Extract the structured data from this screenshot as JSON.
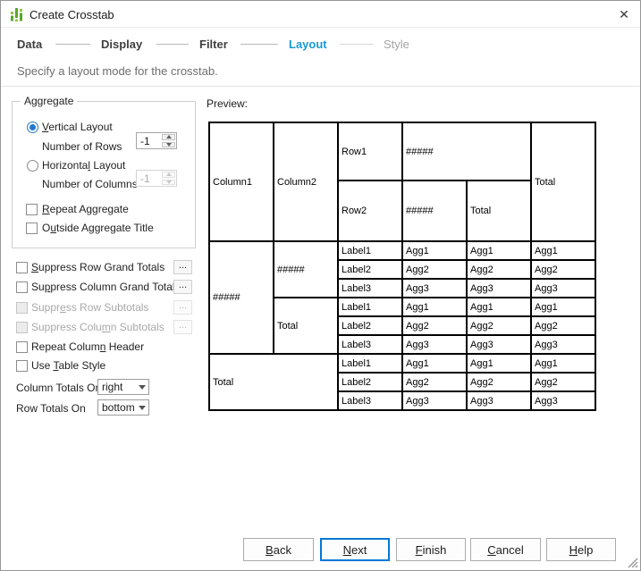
{
  "window": {
    "title": "Create Crosstab",
    "close_glyph": "✕"
  },
  "colors": {
    "active_step": "#1899d6",
    "default_button_border": "#0078d7",
    "app_icon_green": "#5ba829"
  },
  "steps": [
    {
      "label": "Data",
      "state": "done"
    },
    {
      "label": "Display",
      "state": "done"
    },
    {
      "label": "Filter",
      "state": "done"
    },
    {
      "label": "Layout",
      "state": "active"
    },
    {
      "label": "Style",
      "state": "upcoming"
    }
  ],
  "subtitle": "Specify a layout mode for the crosstab.",
  "aggregate": {
    "legend": "Aggregate",
    "vertical_layout": {
      "pre": "",
      "key": "V",
      "post": "ertical Layout",
      "selected": true
    },
    "number_of_rows": {
      "label": "Number of Rows",
      "value": "-1"
    },
    "horizontal_layout": {
      "pre": "Horizonta",
      "key": "l",
      "post": " Layout",
      "selected": false
    },
    "number_of_columns": {
      "label": "Number of Columns",
      "value": "-1",
      "disabled": true
    },
    "repeat_aggregate": {
      "pre": "",
      "key": "R",
      "post": "epeat Aggregate",
      "checked": false
    },
    "outside_aggregate_title": {
      "pre": "O",
      "key": "u",
      "post": "tside Aggregate Title",
      "checked": false
    }
  },
  "options": [
    {
      "pre": "",
      "key": "S",
      "post": "uppress Row Grand Totals",
      "checked": false,
      "disabled": false,
      "more": "..."
    },
    {
      "pre": "Su",
      "key": "p",
      "post": "press Column Grand Totals",
      "checked": false,
      "disabled": false,
      "more": "..."
    },
    {
      "pre": "Suppr",
      "key": "e",
      "post": "ss Row Subtotals",
      "checked": false,
      "disabled": true,
      "more": "..."
    },
    {
      "pre": "Suppress Colu",
      "key": "m",
      "post": "n Subtotals",
      "checked": false,
      "disabled": true,
      "more": "..."
    },
    {
      "pre": "Repeat Colum",
      "key": "n",
      "post": " Header",
      "checked": false,
      "disabled": false
    },
    {
      "pre": "Use ",
      "key": "T",
      "post": "able Style",
      "checked": false,
      "disabled": false
    }
  ],
  "totals": {
    "column": {
      "label": "Column Totals On",
      "value": "right"
    },
    "row": {
      "label": "Row Totals On",
      "value": "bottom"
    }
  },
  "preview": {
    "label": "Preview:",
    "header": {
      "column1": "Column1",
      "column2": "Column2",
      "row1": "Row1",
      "row1_agg": "#####",
      "row2": "Row2",
      "row2_agg": "#####",
      "col_total": "Total",
      "grand_total": "Total"
    },
    "body": {
      "row_stub": "#####",
      "group1_stub": "#####",
      "group2_stub": "Total",
      "grand_stub": "Total",
      "rows": [
        [
          "Label1",
          "Agg1",
          "Agg1",
          "Agg1"
        ],
        [
          "Label2",
          "Agg2",
          "Agg2",
          "Agg2"
        ],
        [
          "Label3",
          "Agg3",
          "Agg3",
          "Agg3"
        ],
        [
          "Label1",
          "Agg1",
          "Agg1",
          "Agg1"
        ],
        [
          "Label2",
          "Agg2",
          "Agg2",
          "Agg2"
        ],
        [
          "Label3",
          "Agg3",
          "Agg3",
          "Agg3"
        ],
        [
          "Label1",
          "Agg1",
          "Agg1",
          "Agg1"
        ],
        [
          "Label2",
          "Agg2",
          "Agg2",
          "Agg2"
        ],
        [
          "Label3",
          "Agg3",
          "Agg3",
          "Agg3"
        ]
      ]
    }
  },
  "buttons": {
    "back": {
      "pre": "",
      "key": "B",
      "post": "ack"
    },
    "next": {
      "pre": "",
      "key": "N",
      "post": "ext"
    },
    "finish": {
      "pre": "",
      "key": "F",
      "post": "inish"
    },
    "cancel": {
      "pre": "",
      "key": "C",
      "post": "ancel"
    },
    "help": {
      "pre": "",
      "key": "H",
      "post": "elp"
    }
  }
}
